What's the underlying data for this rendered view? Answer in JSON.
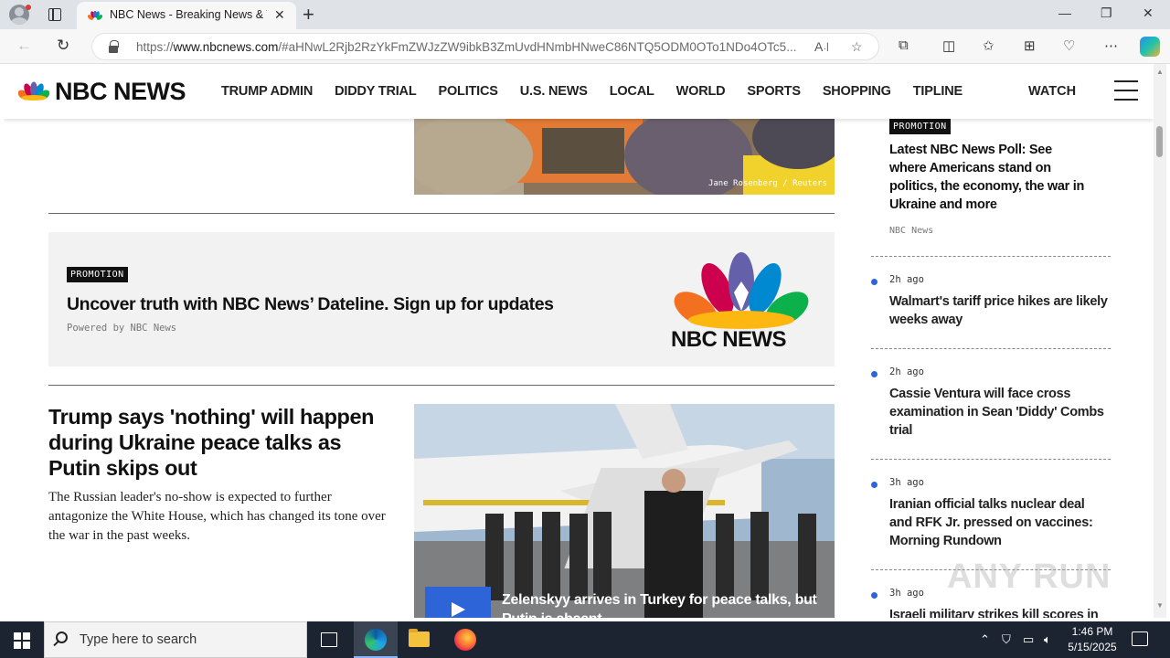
{
  "browser": {
    "tab_title": "NBC News - Breaking News & To",
    "url_prefix": "https://",
    "url_domain": "www.nbcnews.com",
    "url_rest": "/#aHNwL2Rjb2RzYkFmZWJzZW9ibkB3ZmUvdHNmbHNweC86NTQ5ODM0OTo1NDo4OTc5..."
  },
  "site": {
    "logo_text": "NBC NEWS",
    "nav": [
      "TRUMP ADMIN",
      "DIDDY TRIAL",
      "POLITICS",
      "U.S. NEWS",
      "LOCAL",
      "WORLD",
      "SPORTS",
      "SHOPPING",
      "TIPLINE"
    ],
    "watch_label": "WATCH"
  },
  "top_image": {
    "credit": "Jane Rosenberg / Reuters"
  },
  "promo": {
    "badge": "PROMOTION",
    "headline": "Uncover truth with NBC News’ Dateline. Sign up for updates",
    "powered_by": "Powered by NBC News",
    "logo_text": "NBC NEWS"
  },
  "story": {
    "headline": "Trump says 'nothing' will happen during Ukraine peace talks as Putin skips out",
    "dek": "The Russian leader's no-show is expected to further antagonize the White House, which has changed its tone over the war in the past weeks.",
    "video_caption": "Zelenskyy arrives in Turkey for peace talks, but Putin is absent"
  },
  "rail": {
    "promo_badge": "PROMOTION",
    "promo_title": "Latest NBC News Poll: See where Americans stand on politics, the economy, the war in Ukraine and more",
    "promo_source": "NBC News",
    "items": [
      {
        "time": "2h ago",
        "title": "Walmart's tariff price hikes are likely weeks away"
      },
      {
        "time": "2h ago",
        "title": "Cassie Ventura will face cross examination in Sean 'Diddy' Combs trial"
      },
      {
        "time": "3h ago",
        "title": "Iranian official talks nuclear deal and RFK Jr. pressed on vaccines: Morning Rundown"
      },
      {
        "time": "3h ago",
        "title": "Israeli military strikes kill scores in"
      }
    ]
  },
  "watermark": "ANY RUN",
  "taskbar": {
    "search_placeholder": "Type here to search",
    "time": "1:46 PM",
    "date": "5/15/2025"
  },
  "colors": {
    "accent_blue": "#2d65d8",
    "taskbar": "#1d2431"
  }
}
